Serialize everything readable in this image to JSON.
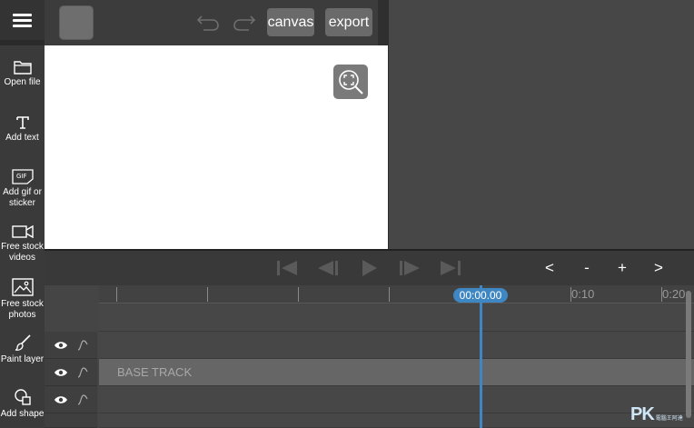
{
  "sidebar": {
    "tools": [
      {
        "label": "Open file",
        "icon": "folder-icon"
      },
      {
        "label": "Add text",
        "icon": "text-icon"
      },
      {
        "label": "Add gif or sticker",
        "icon": "gif-icon"
      },
      {
        "label": "Free stock videos",
        "icon": "video-camera-icon"
      },
      {
        "label": "Free stock photos",
        "icon": "image-icon"
      },
      {
        "label": "Paint layer",
        "icon": "paint-brush-icon"
      },
      {
        "label": "Add shape",
        "icon": "shapes-icon"
      }
    ]
  },
  "toolbar": {
    "canvas_label": "canvas",
    "export_label": "export"
  },
  "playback": {
    "zoom_prev": "<",
    "zoom_out": "-",
    "zoom_in": "+",
    "zoom_next": ">"
  },
  "timeline": {
    "current_time": "00:00.00",
    "ruler_labels": [
      "0:10",
      "0:20"
    ],
    "base_track_label": "BASE TRACK"
  },
  "watermark": {
    "brand": "PK",
    "subtext": "電腦王阿達"
  },
  "colors": {
    "accent": "#3e87c2",
    "canvas": "#ffffff",
    "background": "#404040"
  }
}
